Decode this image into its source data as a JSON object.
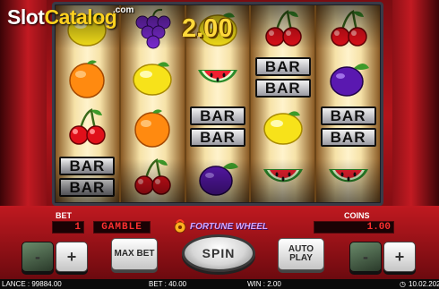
{
  "logo": {
    "part1": "Slot",
    "part2": "Catalog",
    "com": ".com"
  },
  "win_display": "2.00",
  "reels": [
    [
      "lemon",
      "orange",
      "cherry",
      "bar"
    ],
    [
      "grape",
      "lemon",
      "orange",
      "cherry"
    ],
    [
      "lemon",
      "watermelon",
      "bar",
      "plum"
    ],
    [
      "cherry",
      "bar",
      "lemon",
      "watermelon"
    ],
    [
      "cherry",
      "plum",
      "bar",
      "watermelon"
    ]
  ],
  "bar_label": "BAR",
  "panel": {
    "bet_label": "BET",
    "bet_display": "1",
    "gamble_label": "GAMBLE",
    "fortune_label": "FORTUNE WHEEL",
    "coins_label": "COINS",
    "coins_display": "1.00"
  },
  "buttons": {
    "max_bet": "MAX BET",
    "spin": "SPIN",
    "auto_play": "AUTO PLAY",
    "minus": "-",
    "plus": "+"
  },
  "status": {
    "balance": "LANCE : 99884.00",
    "bet": "BET : 40.00",
    "win": "WIN : 2.00",
    "date": "10.02.202"
  },
  "colors": {
    "accent": "#ffd83a",
    "cabinet": "#b3141b",
    "led": "#ff3030"
  }
}
